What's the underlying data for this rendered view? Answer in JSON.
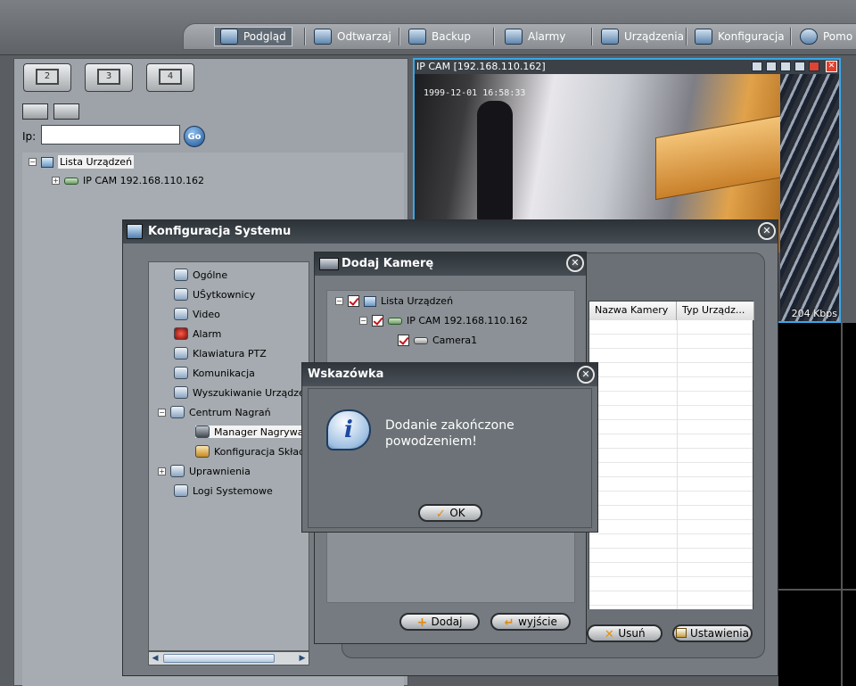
{
  "toolbar": {
    "items": [
      {
        "label": "Podgląd",
        "icon": "monitor-icon",
        "active": true
      },
      {
        "label": "Odtwarzaj",
        "icon": "film-icon"
      },
      {
        "label": "Backup",
        "icon": "backup-icon"
      },
      {
        "label": "Alarmy",
        "icon": "alarm-icon"
      },
      {
        "label": "Urządzenia",
        "icon": "gear-icon"
      },
      {
        "label": "Konfiguracja",
        "icon": "config-icon"
      },
      {
        "label": "Pomo",
        "icon": "help-icon"
      }
    ]
  },
  "left_panel": {
    "split_buttons": [
      "2",
      "3",
      "4"
    ],
    "ip_label": "Ip:",
    "ip_value": "",
    "go_label": "Go",
    "tree": {
      "root": "Lista Urządzeń",
      "device": "IP CAM 192.168.110.162"
    }
  },
  "video": {
    "title": "IP CAM [192.168.110.162]",
    "timestamp": "1999-12-01  16:58:33",
    "bitrate": "204 Kbps"
  },
  "konfig_dialog": {
    "title": "Konfiguracja Systemu",
    "tree": [
      {
        "label": "Ogólne",
        "icon": "general-icon"
      },
      {
        "label": "UŜytkownicy",
        "icon": "users-icon"
      },
      {
        "label": "Video",
        "icon": "video-icon"
      },
      {
        "label": "Alarm",
        "icon": "alarm-icon"
      },
      {
        "label": "Klawiatura PTZ",
        "icon": "keyboard-icon"
      },
      {
        "label": "Komunikacja",
        "icon": "network-icon"
      },
      {
        "label": "Wyszukiwanie Urządzeń",
        "icon": "search-device-icon"
      },
      {
        "label": "Centrum Nagrań",
        "icon": "record-center-icon"
      },
      {
        "label": "Manager Nagrywan",
        "icon": "recorder-icon",
        "selected": true
      },
      {
        "label": "Konfiguracja Składo",
        "icon": "storage-icon"
      },
      {
        "label": "Uprawnienia",
        "icon": "permissions-icon"
      },
      {
        "label": "Logi Systemowe",
        "icon": "logs-icon"
      }
    ],
    "table_headers": [
      "Nazwa Kamery",
      "Typ Urządz..."
    ],
    "buttons": {
      "delete": "Usuń",
      "settings": "Ustawienia"
    }
  },
  "dodaj_dialog": {
    "title": "Dodaj Kamerę",
    "tree": {
      "root": "Lista Urządzeń",
      "device": "IP CAM 192.168.110.162",
      "camera": "Camera1"
    },
    "buttons": {
      "add": "Dodaj",
      "exit": "wyjście"
    }
  },
  "wskazowka_dialog": {
    "title": "Wskazówka",
    "message_line1": "Dodanie zakończone",
    "message_line2": "powodzeniem!",
    "ok_label": "OK"
  }
}
